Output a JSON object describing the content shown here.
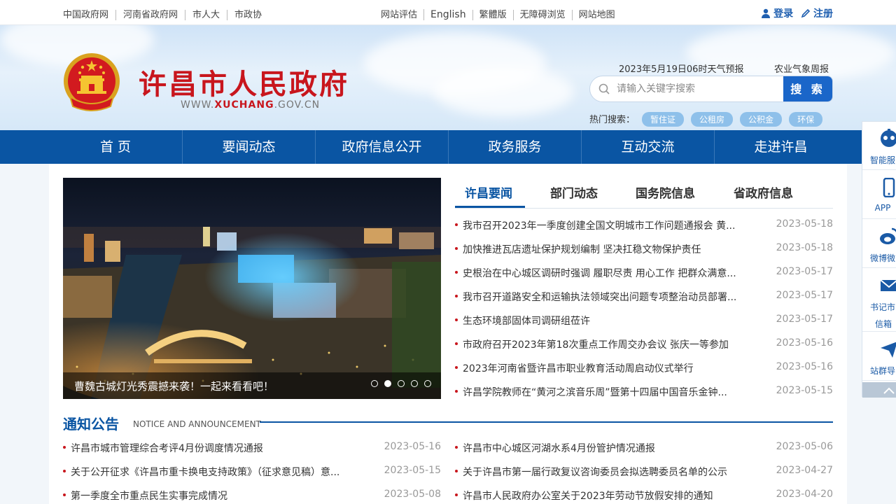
{
  "topbar": {
    "links": [
      "中国政府网",
      "河南省政府网",
      "市人大",
      "市政协"
    ],
    "mid": [
      "网站评估",
      "English",
      "繁體版",
      "无障碍浏览",
      "网站地图"
    ],
    "login": "登录",
    "register": "注册"
  },
  "header": {
    "title": "许昌市人民政府",
    "url_prefix": "WWW.",
    "url_brand": "XUCHANG",
    "url_suffix": ".GOV.CN",
    "weather": "2023年5月19日06时天气预报",
    "weekly": "农业气象周报",
    "search_placeholder": "请输入关键字搜索",
    "search_button": "搜 索",
    "hot_label": "热门搜索：",
    "hot_tags": [
      "暂住证",
      "公租房",
      "公积金",
      "环保"
    ]
  },
  "nav": [
    "首 页",
    "要闻动态",
    "政府信息公开",
    "政务服务",
    "互动交流",
    "走进许昌"
  ],
  "slider": {
    "caption": "曹魏古城灯光秀震撼来袭！一起来看看吧！",
    "dot_count": 5,
    "active_dot": 2
  },
  "news": {
    "tabs": [
      "许昌要闻",
      "部门动态",
      "国务院信息",
      "省政府信息"
    ],
    "items": [
      {
        "title": "我市召开2023年一季度创建全国文明城市工作问题通报会 黄...",
        "date": "2023-05-18"
      },
      {
        "title": "加快推进瓦店遗址保护规划编制 坚决扛稳文物保护责任",
        "date": "2023-05-18"
      },
      {
        "title": "史根治在中心城区调研时强调 履职尽责 用心工作 把群众满意...",
        "date": "2023-05-17"
      },
      {
        "title": "我市召开道路安全和运输执法领域突出问题专项整治动员部署...",
        "date": "2023-05-17"
      },
      {
        "title": "生态环境部固体司调研组莅许",
        "date": "2023-05-17"
      },
      {
        "title": "市政府召开2023年第18次重点工作周交办会议 张庆一等参加",
        "date": "2023-05-16"
      },
      {
        "title": "2023年河南省暨许昌市职业教育活动周启动仪式举行",
        "date": "2023-05-16"
      },
      {
        "title": "许昌学院教师在“黄河之滨音乐周”暨第十四届中国音乐金钟...",
        "date": "2023-05-15"
      }
    ]
  },
  "notice": {
    "title": "通知公告",
    "subtitle": "NOTICE AND ANNOUNCEMENT",
    "left": [
      {
        "title": "许昌市城市管理综合考评4月份调度情况通报",
        "date": "2023-05-16"
      },
      {
        "title": "关于公开征求《许昌市重卡换电支持政策》（征求意见稿）意...",
        "date": "2023-05-15"
      },
      {
        "title": "第一季度全市重点民生实事完成情况",
        "date": "2023-05-08"
      }
    ],
    "right": [
      {
        "title": "许昌市中心城区河湖水系4月份管护情况通报",
        "date": "2023-05-06"
      },
      {
        "title": "关于许昌市第一届行政复议咨询委员会拟选聘委员名单的公示",
        "date": "2023-04-27"
      },
      {
        "title": "许昌市人民政府办公室关于2023年劳动节放假安排的通知",
        "date": "2023-04-20"
      }
    ]
  },
  "sidebar": [
    {
      "label": "智能服",
      "icon": "robot-icon"
    },
    {
      "label": "APP",
      "icon": "phone-icon"
    },
    {
      "label": "微博微",
      "icon": "weibo-icon"
    },
    {
      "label": "书记市",
      "label2": "信箱",
      "icon": "mail-icon"
    },
    {
      "label": "站群导",
      "icon": "send-icon"
    }
  ],
  "colors": {
    "primary": "#0a55a3",
    "accent": "#c8161d",
    "button": "#1a66c9"
  }
}
